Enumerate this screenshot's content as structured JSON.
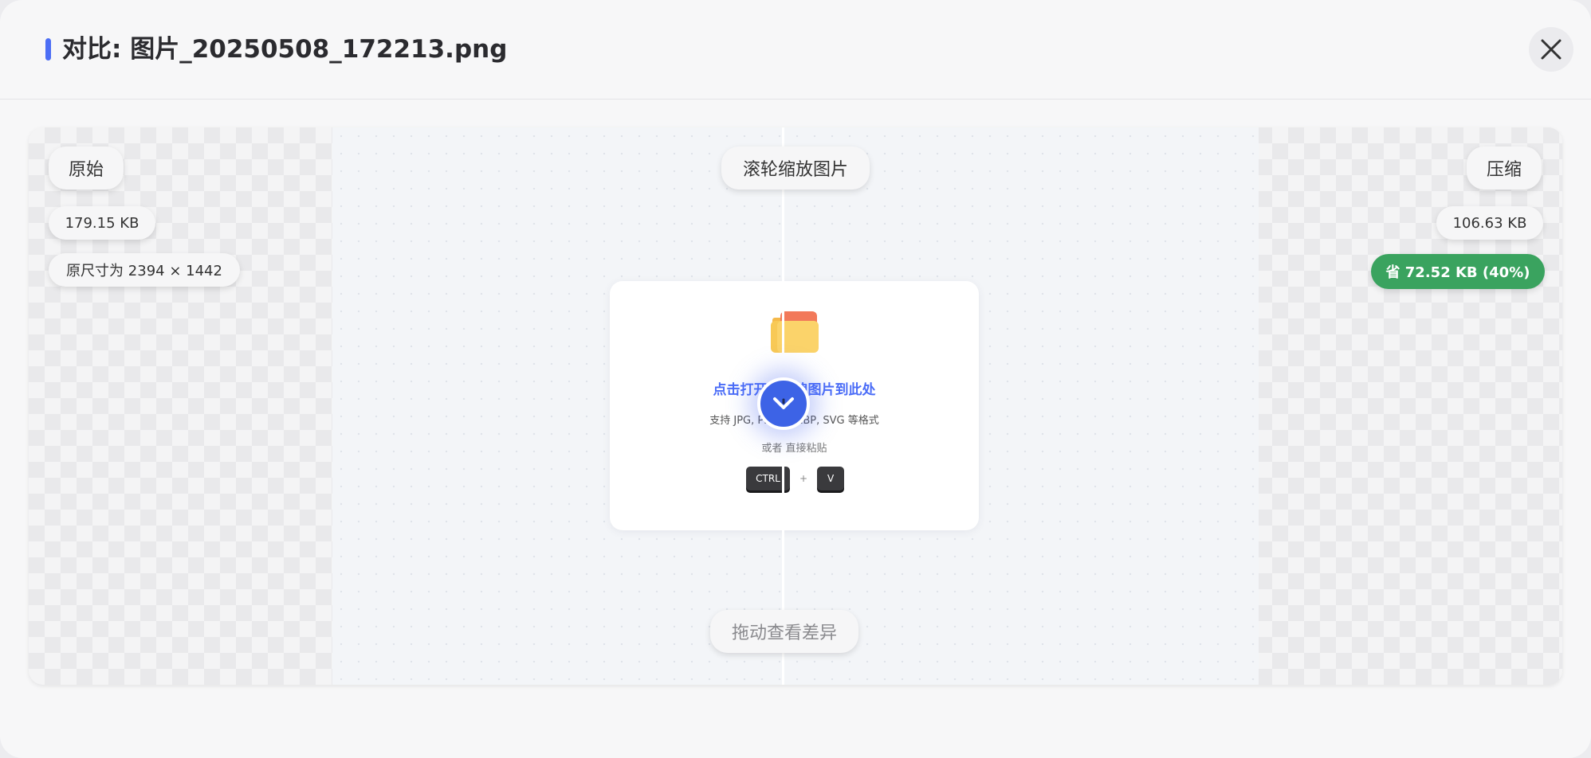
{
  "modal": {
    "title": "对比: 图片_20250508_172213.png",
    "accent_color": "#4c6ef5",
    "close_icon": "close-icon"
  },
  "compare": {
    "left_label": "原始",
    "left_size": "179.15 KB",
    "left_dimensions": "原尺寸为 2394 × 1442",
    "right_label": "压缩",
    "right_size": "106.63 KB",
    "savings": "省 72.52 KB (40%)",
    "savings_color": "#3aa35f",
    "zoom_hint": "滚轮缩放图片",
    "drag_hint": "拖动查看差异",
    "handle_icon": "chevron-compare-icon"
  },
  "drop_zone": {
    "icon": "folder-icon",
    "title": "点击打开或拖拽图片到此处",
    "formats": "支持 JPG, PNG, WEBP, SVG 等格式",
    "or_text": "或者 直接粘贴",
    "key_ctrl": "CTRL",
    "key_plus": "+",
    "key_v": "V"
  }
}
